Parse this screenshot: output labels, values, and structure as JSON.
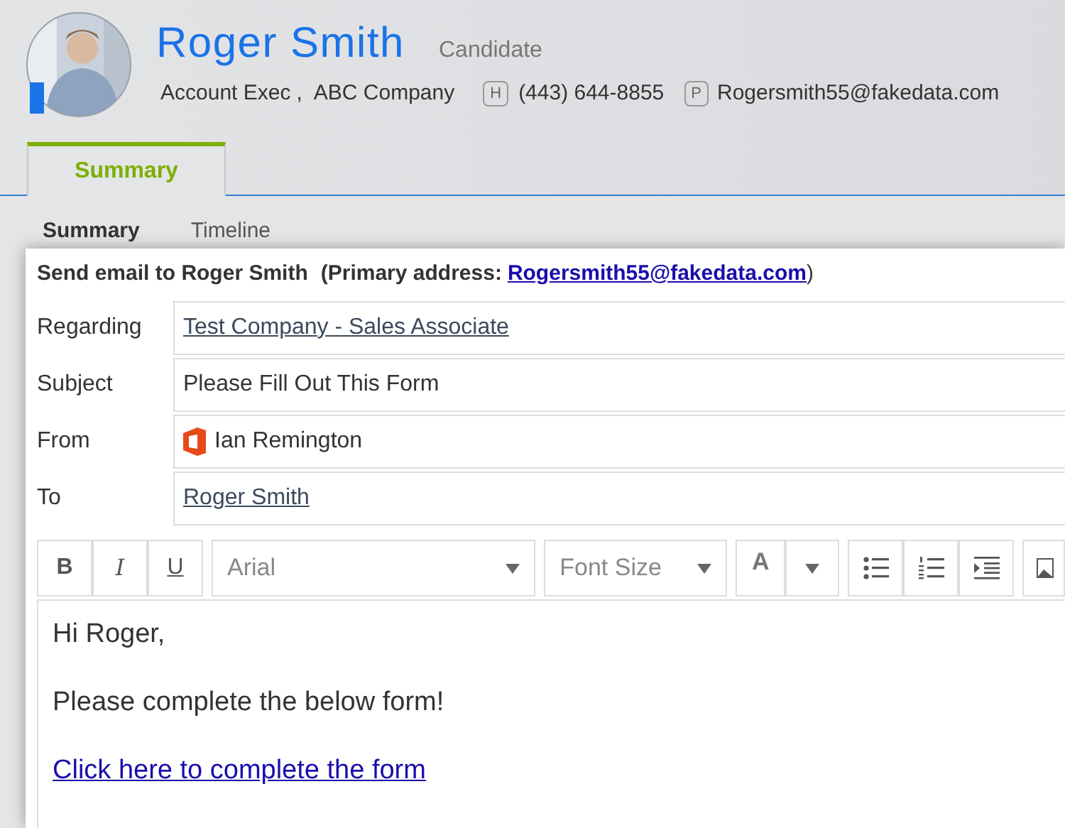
{
  "profile": {
    "name": "Roger Smith",
    "role": "Candidate",
    "job_title": "Account Exec",
    "separator": ",",
    "company": "ABC Company",
    "phone_label": "H",
    "phone": "(443) 644-8855",
    "email_label": "P",
    "email": "Rogersmith55@fakedata.com"
  },
  "tabs": [
    {
      "label": "Summary",
      "selected": true
    }
  ],
  "subtabs": [
    {
      "label": "Summary",
      "selected": true
    },
    {
      "label": "Timeline",
      "selected": false
    }
  ],
  "email_dialog": {
    "heading": "Send email to Roger Smith",
    "note_open": "(Primary address:",
    "note_email": "Rogersmith55@fakedata.com",
    "note_close": ")",
    "fields": [
      {
        "label": "Regarding",
        "value": "Test Company - Sales Associate",
        "kind": "link"
      },
      {
        "label": "Subject",
        "value": "Please Fill Out This Form",
        "kind": "text"
      },
      {
        "label": "From",
        "value": "Ian Remington",
        "kind": "sender"
      },
      {
        "label": "To",
        "value": "Roger Smith",
        "kind": "link"
      }
    ],
    "toolbar": {
      "format_buttons": [
        "B",
        "I",
        "U"
      ],
      "font": "Arial",
      "font_size": "Font Size",
      "color_button": "A"
    },
    "body": [
      {
        "text": "Hi Roger,",
        "kind": "text"
      },
      {
        "text": "Please complete the below form!",
        "kind": "text"
      },
      {
        "text": "Click here to complete the form",
        "kind": "link"
      }
    ]
  }
}
